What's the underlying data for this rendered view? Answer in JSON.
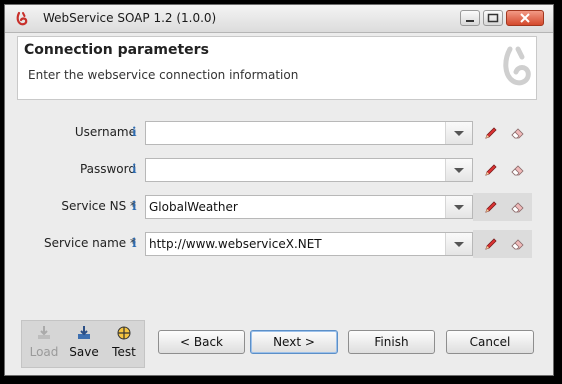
{
  "window": {
    "title": "WebService SOAP 1.2 (1.0.0)"
  },
  "header": {
    "title": "Connection parameters",
    "description": "Enter the webservice connection information"
  },
  "fields": [
    {
      "label": "Username",
      "value": ""
    },
    {
      "label": "Password",
      "value": ""
    },
    {
      "label": "Service NS *",
      "value": "GlobalWeather"
    },
    {
      "label": "Service name *",
      "value": "http://www.webserviceX.NET"
    }
  ],
  "info_glyph": "i",
  "toolbar": {
    "load_label": "Load",
    "save_label": "Save",
    "test_label": "Test"
  },
  "buttons": {
    "back": "< Back",
    "next": "Next >",
    "finish": "Finish",
    "cancel": "Cancel"
  },
  "colors": {
    "accent": "#c8302b",
    "info": "#2e6cb2"
  }
}
